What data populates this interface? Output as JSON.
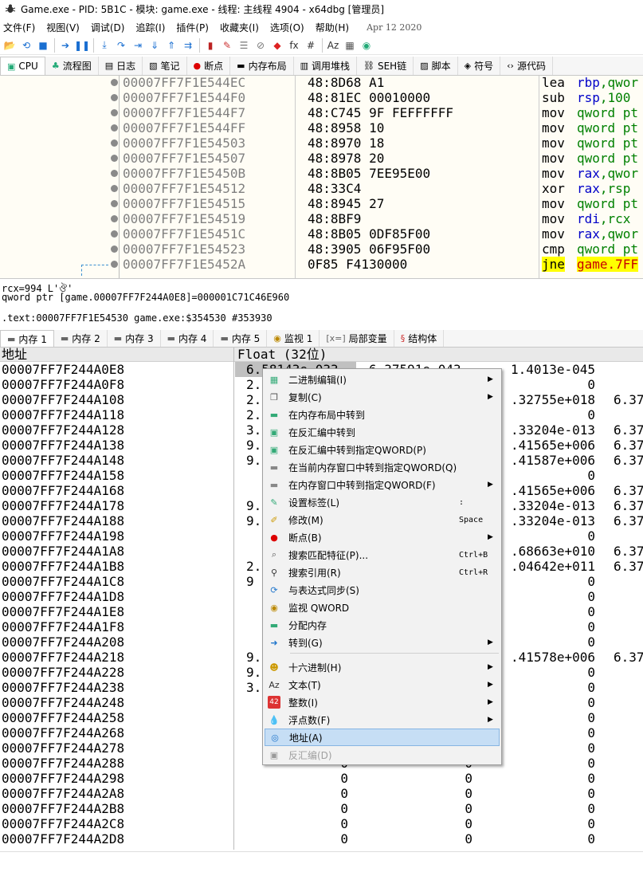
{
  "window": {
    "title": "Game.exe - PID: 5B1C - 模块: game.exe - 线程: 主线程 4904 - x64dbg [管理员]"
  },
  "menu": [
    "文件(F)",
    "视图(V)",
    "调试(D)",
    "追踪(I)",
    "插件(P)",
    "收藏夹(I)",
    "选项(O)",
    "帮助(H)"
  ],
  "menu_date": "Apr 12 2020",
  "toolbar": [
    "open-icon",
    "restart-icon",
    "stop-icon",
    "run-icon",
    "pause-icon",
    "step-into-icon",
    "step-over-icon",
    "trace-into-icon",
    "trace-over-icon",
    "execute-till-return-icon",
    "run-to-user-code-icon",
    "scylla-icon",
    "patch-icon",
    "comment-icon",
    "label-icon",
    "bookmark-icon",
    "function-icon",
    "hash-icon",
    "strings-icon",
    "calculator-icon",
    "globe-icon"
  ],
  "top_tabs": [
    {
      "icon": "cpu-icon",
      "label": "CPU"
    },
    {
      "icon": "tree-icon",
      "label": "流程图"
    },
    {
      "icon": "log-icon",
      "label": "日志"
    },
    {
      "icon": "notes-icon",
      "label": "笔记"
    },
    {
      "icon": "breakpoint-icon",
      "label": "断点"
    },
    {
      "icon": "memory-map-icon",
      "label": "内存布局"
    },
    {
      "icon": "callstack-icon",
      "label": "调用堆栈"
    },
    {
      "icon": "seh-icon",
      "label": "SEH链"
    },
    {
      "icon": "script-icon",
      "label": "脚本"
    },
    {
      "icon": "symbols-icon",
      "label": "符号"
    },
    {
      "icon": "source-icon",
      "label": "源代码"
    }
  ],
  "disasm": [
    {
      "addr": "00007FF7F1E544EC",
      "bytes": "48:8D68 A1",
      "mn": "lea",
      "ops_kw": "rbp",
      "ops_rest": ",qwor"
    },
    {
      "addr": "00007FF7F1E544F0",
      "bytes": "48:81EC 00010000",
      "mn": "sub",
      "ops_kw": "rsp",
      "ops_rest": ",100"
    },
    {
      "addr": "00007FF7F1E544F7",
      "bytes": "48:C745 9F FEFFFFFF",
      "mn": "mov",
      "ops_kw": "",
      "ops_rest": "qword pt"
    },
    {
      "addr": "00007FF7F1E544FF",
      "bytes": "48:8958 10",
      "mn": "mov",
      "ops_kw": "",
      "ops_rest": "qword pt"
    },
    {
      "addr": "00007FF7F1E54503",
      "bytes": "48:8970 18",
      "mn": "mov",
      "ops_kw": "",
      "ops_rest": "qword pt"
    },
    {
      "addr": "00007FF7F1E54507",
      "bytes": "48:8978 20",
      "mn": "mov",
      "ops_kw": "",
      "ops_rest": "qword pt"
    },
    {
      "addr": "00007FF7F1E5450B",
      "bytes": "48:8B05 7EE95E00",
      "mn": "mov",
      "ops_kw": "rax",
      "ops_rest": ",qwor"
    },
    {
      "addr": "00007FF7F1E54512",
      "bytes": "48:33C4",
      "mn": "xor",
      "ops_kw": "rax",
      "ops_rest": ",rsp"
    },
    {
      "addr": "00007FF7F1E54515",
      "bytes": "48:8945 27",
      "mn": "mov",
      "ops_kw": "",
      "ops_rest": "qword pt"
    },
    {
      "addr": "00007FF7F1E54519",
      "bytes": "48:8BF9",
      "mn": "mov",
      "ops_kw": "rdi",
      "ops_rest": ",rcx"
    },
    {
      "addr": "00007FF7F1E5451C",
      "bytes": "48:8B05 0DF85F00",
      "mn": "mov",
      "ops_kw": "rax",
      "ops_rest": ",qwor"
    },
    {
      "addr": "00007FF7F1E54523",
      "bytes": "48:3905 06F95F00",
      "mn": "cmp",
      "ops_kw": "",
      "ops_rest": "qword pt"
    },
    {
      "addr": "00007FF7F1E5452A",
      "bytes": "0F85 F4130000",
      "mn": "jne",
      "ops_kw": "",
      "ops_rest": "game.7FF"
    }
  ],
  "info": {
    "line1": "rcx=994 L'ঔ'",
    "line2": "qword ptr [game.00007FF7F244A0E8]=000001C71C46E960",
    "line3": ".text:00007FF7F1E54530 game.exe:$354530 #353930"
  },
  "mem_tabs": [
    {
      "icon": "memory-icon",
      "label": "内存 1"
    },
    {
      "icon": "memory-icon",
      "label": "内存 2"
    },
    {
      "icon": "memory-icon",
      "label": "内存 3"
    },
    {
      "icon": "memory-icon",
      "label": "内存 4"
    },
    {
      "icon": "memory-icon",
      "label": "内存 5"
    },
    {
      "icon": "watch-icon",
      "label": "监视 1"
    },
    {
      "icon": "locals-icon",
      "label": "局部变量"
    },
    {
      "icon": "struct-icon",
      "label": "结构体"
    }
  ],
  "dump_header": {
    "col_addr": "地址",
    "col_float": "Float (32位)"
  },
  "dump_rows": [
    {
      "a": "00007FF7F244A0E8",
      "c1": "6.58143e-033",
      "c2": "6.37591e-043",
      "c3": "1.4013e-045",
      "c4": ""
    },
    {
      "a": "00007FF7F244A0F8",
      "c1": "2.",
      "c2": "",
      "c3": "0",
      "c4": ""
    },
    {
      "a": "00007FF7F244A108",
      "c1": "2.",
      "c2": "",
      "c3": ".32755e+018",
      "c4": "6.37"
    },
    {
      "a": "00007FF7F244A118",
      "c1": "2.",
      "c2": "",
      "c3": "0",
      "c4": ""
    },
    {
      "a": "00007FF7F244A128",
      "c1": "3.",
      "c2": "",
      "c3": ".33204e-013",
      "c4": "6.37"
    },
    {
      "a": "00007FF7F244A138",
      "c1": "9.",
      "c2": "",
      "c3": ".41565e+006",
      "c4": "6.37"
    },
    {
      "a": "00007FF7F244A148",
      "c1": "9.",
      "c2": "",
      "c3": ".41587e+006",
      "c4": "6.37"
    },
    {
      "a": "00007FF7F244A158",
      "c1": "",
      "c2": "",
      "c3": "0",
      "c4": ""
    },
    {
      "a": "00007FF7F244A168",
      "c1": "",
      "c2": "",
      "c3": ".41565e+006",
      "c4": "6.37"
    },
    {
      "a": "00007FF7F244A178",
      "c1": "9.",
      "c2": "",
      "c3": ".33204e-013",
      "c4": "6.37"
    },
    {
      "a": "00007FF7F244A188",
      "c1": "9.",
      "c2": "",
      "c3": ".33204e-013",
      "c4": "6.37"
    },
    {
      "a": "00007FF7F244A198",
      "c1": "",
      "c2": "",
      "c3": "0",
      "c4": ""
    },
    {
      "a": "00007FF7F244A1A8",
      "c1": "",
      "c2": "",
      "c3": ".68663e+010",
      "c4": "6.37"
    },
    {
      "a": "00007FF7F244A1B8",
      "c1": "2.",
      "c2": "",
      "c3": ".04642e+011",
      "c4": "6.37"
    },
    {
      "a": "00007FF7F244A1C8",
      "c1": "9",
      "c2": "",
      "c3": "0",
      "c4": ""
    },
    {
      "a": "00007FF7F244A1D8",
      "c1": "",
      "c2": "",
      "c3": "0",
      "c4": ""
    },
    {
      "a": "00007FF7F244A1E8",
      "c1": "",
      "c2": "",
      "c3": "0",
      "c4": ""
    },
    {
      "a": "00007FF7F244A1F8",
      "c1": "",
      "c2": "",
      "c3": "0",
      "c4": ""
    },
    {
      "a": "00007FF7F244A208",
      "c1": "",
      "c2": "",
      "c3": "0",
      "c4": ""
    },
    {
      "a": "00007FF7F244A218",
      "c1": "9.",
      "c2": "",
      "c3": ".41578e+006",
      "c4": "6.37"
    },
    {
      "a": "00007FF7F244A228",
      "c1": "9.",
      "c2": "",
      "c3": "0",
      "c4": ""
    },
    {
      "a": "00007FF7F244A238",
      "c1": "3.",
      "c2": "",
      "c3": "0",
      "c4": ""
    },
    {
      "a": "00007FF7F244A248",
      "c1": "",
      "c2": "",
      "c3": "0",
      "c4": ""
    },
    {
      "a": "00007FF7F244A258",
      "c1": "",
      "c2": "",
      "c3": "0",
      "c4": ""
    },
    {
      "a": "00007FF7F244A268",
      "c1": "",
      "c2": "",
      "c3": "0",
      "c4": ""
    },
    {
      "a": "00007FF7F244A278",
      "c1": "",
      "c2": "",
      "c3": "0",
      "c4": ""
    },
    {
      "a": "00007FF7F244A288",
      "c1": "0",
      "c2": "0",
      "c3": "0",
      "c4": ""
    },
    {
      "a": "00007FF7F244A298",
      "c1": "0",
      "c2": "0",
      "c3": "0",
      "c4": ""
    },
    {
      "a": "00007FF7F244A2A8",
      "c1": "0",
      "c2": "0",
      "c3": "0",
      "c4": ""
    },
    {
      "a": "00007FF7F244A2B8",
      "c1": "0",
      "c2": "0",
      "c3": "0",
      "c4": ""
    },
    {
      "a": "00007FF7F244A2C8",
      "c1": "0",
      "c2": "0",
      "c3": "0",
      "c4": ""
    },
    {
      "a": "00007FF7F244A2D8",
      "c1": "0",
      "c2": "0",
      "c3": "0",
      "c4": ""
    }
  ],
  "context_menu": [
    {
      "icon": "binary-edit-icon",
      "label": "二进制编辑(I)",
      "shortcut": "",
      "submenu": true,
      "disabled": false,
      "hl": false
    },
    {
      "icon": "copy-icon",
      "label": "复制(C)",
      "shortcut": "",
      "submenu": true,
      "disabled": false,
      "hl": false
    },
    {
      "icon": "memory-map-goto-icon",
      "label": "在内存布局中转到",
      "shortcut": "",
      "submenu": false,
      "disabled": false,
      "hl": false
    },
    {
      "icon": "disasm-goto-icon",
      "label": "在反汇编中转到",
      "shortcut": "",
      "submenu": false,
      "disabled": false,
      "hl": false
    },
    {
      "icon": "disasm-goto-qword-icon",
      "label": "在反汇编中转到指定QWORD(P)",
      "shortcut": "",
      "submenu": false,
      "disabled": false,
      "hl": false
    },
    {
      "icon": "dump-goto-qword-icon",
      "label": "在当前内存窗口中转到指定QWORD(Q)",
      "shortcut": "",
      "submenu": false,
      "disabled": false,
      "hl": false
    },
    {
      "icon": "dump-window-goto-icon",
      "label": "在内存窗口中转到指定QWORD(F)",
      "shortcut": "",
      "submenu": true,
      "disabled": false,
      "hl": false
    },
    {
      "icon": "label-icon",
      "label": "设置标签(L)",
      "shortcut": ":",
      "submenu": false,
      "disabled": false,
      "hl": false
    },
    {
      "icon": "modify-icon",
      "label": "修改(M)",
      "shortcut": "Space",
      "submenu": false,
      "disabled": false,
      "hl": false
    },
    {
      "icon": "breakpoint-icon",
      "label": "断点(B)",
      "shortcut": "",
      "submenu": true,
      "disabled": false,
      "hl": false
    },
    {
      "icon": "search-pattern-icon",
      "label": "搜索匹配特征(P)...",
      "shortcut": "Ctrl+B",
      "submenu": false,
      "disabled": false,
      "hl": false
    },
    {
      "icon": "find-refs-icon",
      "label": "搜索引用(R)",
      "shortcut": "Ctrl+R",
      "submenu": false,
      "disabled": false,
      "hl": false
    },
    {
      "icon": "sync-icon",
      "label": "与表达式同步(S)",
      "shortcut": "",
      "submenu": false,
      "disabled": false,
      "hl": false
    },
    {
      "icon": "watch-icon",
      "label": "监视 QWORD",
      "shortcut": "",
      "submenu": false,
      "disabled": false,
      "hl": false
    },
    {
      "icon": "alloc-memory-icon",
      "label": "分配内存",
      "shortcut": "",
      "submenu": false,
      "disabled": false,
      "hl": false
    },
    {
      "icon": "goto-icon",
      "label": "转到(G)",
      "shortcut": "",
      "submenu": true,
      "disabled": false,
      "hl": false
    },
    {
      "icon": "hex-icon",
      "label": "十六进制(H)",
      "shortcut": "",
      "submenu": true,
      "disabled": false,
      "hl": false
    },
    {
      "icon": "text-icon",
      "label": "文本(T)",
      "shortcut": "",
      "submenu": true,
      "disabled": false,
      "hl": false
    },
    {
      "icon": "integer-icon",
      "label": "整数(I)",
      "shortcut": "",
      "submenu": true,
      "disabled": false,
      "hl": false
    },
    {
      "icon": "float-icon",
      "label": "浮点数(F)",
      "shortcut": "",
      "submenu": true,
      "disabled": false,
      "hl": false
    },
    {
      "icon": "address-icon",
      "label": "地址(A)",
      "shortcut": "",
      "submenu": false,
      "disabled": false,
      "hl": true
    },
    {
      "icon": "disassembly-icon",
      "label": "反汇编(D)",
      "shortcut": "",
      "submenu": false,
      "disabled": true,
      "hl": false
    }
  ]
}
